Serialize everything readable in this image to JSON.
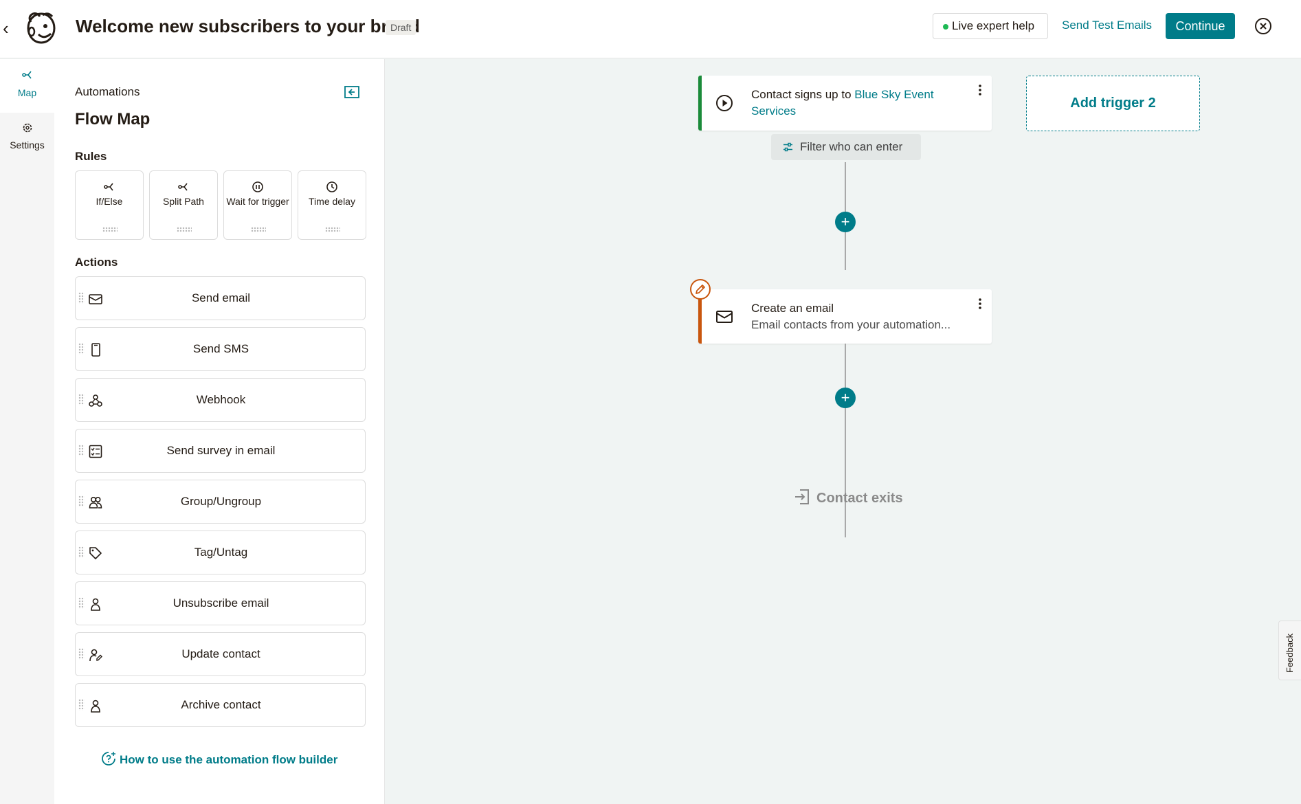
{
  "header": {
    "title": "Welcome new subscribers to your brand",
    "status_badge": "Draft",
    "live_help_label": "Live expert help",
    "send_test_label": "Send Test Emails",
    "continue_label": "Continue"
  },
  "rail": {
    "map_label": "Map",
    "settings_label": "Settings"
  },
  "panel": {
    "breadcrumb": "Automations",
    "title": "Flow Map",
    "rules_heading": "Rules",
    "rules": [
      {
        "label": "If/Else",
        "icon": "branch-icon"
      },
      {
        "label": "Split Path",
        "icon": "split-icon"
      },
      {
        "label": "Wait for trigger",
        "icon": "pause-icon"
      },
      {
        "label": "Time delay",
        "icon": "clock-icon"
      }
    ],
    "actions_heading": "Actions",
    "actions": [
      {
        "label": "Send email",
        "icon": "envelope-icon"
      },
      {
        "label": "Send SMS",
        "icon": "phone-icon"
      },
      {
        "label": "Webhook",
        "icon": "webhook-icon"
      },
      {
        "label": "Send survey in email",
        "icon": "survey-icon"
      },
      {
        "label": "Group/Ungroup",
        "icon": "group-icon"
      },
      {
        "label": "Tag/Untag",
        "icon": "tag-icon"
      },
      {
        "label": "Unsubscribe email",
        "icon": "person-icon"
      },
      {
        "label": "Update contact",
        "icon": "edit-person-icon"
      },
      {
        "label": "Archive contact",
        "icon": "person-icon"
      }
    ],
    "help_link": "How to use the automation flow builder"
  },
  "canvas": {
    "trigger": {
      "prefix": "Contact signs up to",
      "audience": "Blue Sky Event Services"
    },
    "add_trigger_label": "Add trigger 2",
    "filter_label": "Filter who can enter",
    "email_step": {
      "title": "Create an email",
      "subtitle": "Email contacts from your automation..."
    },
    "exit_label": "Contact exits"
  },
  "feedback_label": "Feedback",
  "colors": {
    "accent": "#007c89",
    "trigger_bar": "#1b8b3a",
    "email_bar": "#c9560e",
    "live_dot": "#1db954"
  }
}
